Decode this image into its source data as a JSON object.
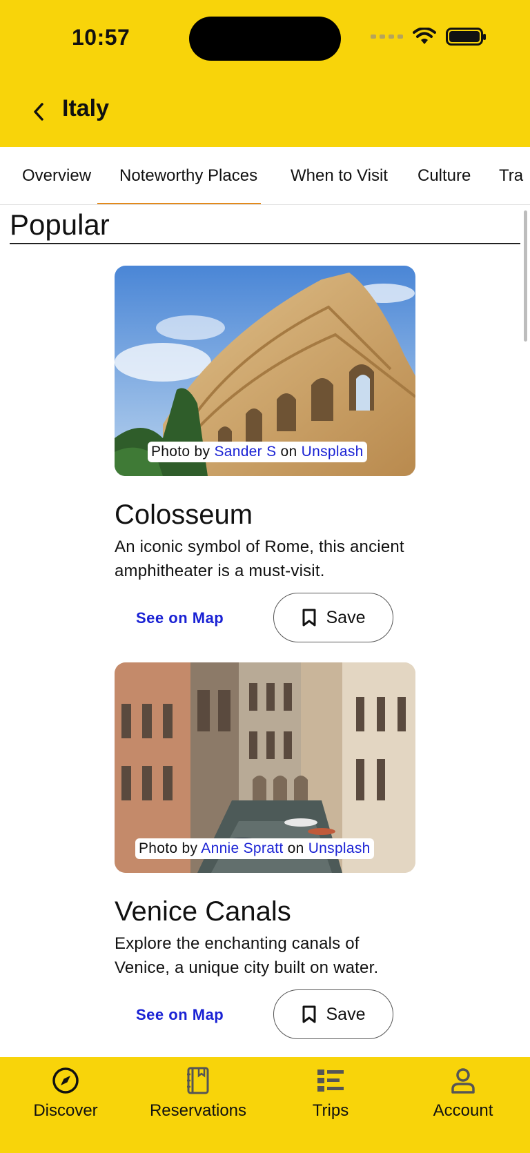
{
  "status_bar": {
    "time": "10:57"
  },
  "header": {
    "title": "Italy",
    "back_icon": "chevron-left-icon"
  },
  "tabs": [
    {
      "label": "Overview",
      "active": false
    },
    {
      "label": "Noteworthy Places",
      "active": true
    },
    {
      "label": "When to Visit",
      "active": false
    },
    {
      "label": "Culture",
      "active": false
    },
    {
      "label": "Tra",
      "active": false
    }
  ],
  "section": {
    "title": "Popular"
  },
  "places": [
    {
      "name": "Colosseum",
      "description": "An iconic symbol of Rome, this ancient amphitheater is a must-visit.",
      "credit": {
        "prefix": "Photo by",
        "author": "Sander S",
        "middle": "on",
        "source": "Unsplash"
      },
      "map_label": "See on Map",
      "save_label": "Save"
    },
    {
      "name": "Venice Canals",
      "description": "Explore the enchanting canals of Venice, a unique city built on water.",
      "credit": {
        "prefix": "Photo by",
        "author": "Annie Spratt",
        "middle": "on",
        "source": "Unsplash"
      },
      "map_label": "See on Map",
      "save_label": "Save"
    }
  ],
  "bottom_nav": [
    {
      "label": "Discover",
      "icon": "compass-icon"
    },
    {
      "label": "Reservations",
      "icon": "book-icon"
    },
    {
      "label": "Trips",
      "icon": "list-icon"
    },
    {
      "label": "Account",
      "icon": "person-icon"
    }
  ],
  "colors": {
    "accent_yellow": "#F8D40A",
    "tab_indicator": "#E38A1C",
    "link_blue": "#1A22D4"
  }
}
